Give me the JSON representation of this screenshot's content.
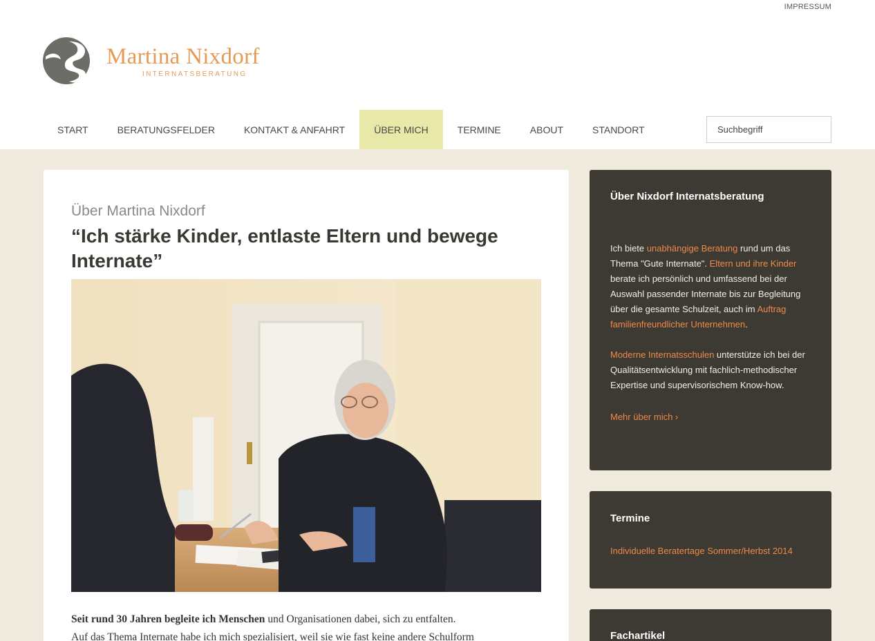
{
  "util_nav": {
    "impressum": "IMPRESSUM"
  },
  "brand": {
    "name": "Martina Nixdorf",
    "tagline": "INTERNATSBERATUNG"
  },
  "nav": {
    "items": [
      "START",
      "BERATUNGSFELDER",
      "KONTAKT & ANFAHRT",
      "ÜBER MICH",
      "TERMINE",
      "ABOUT",
      "STANDORT"
    ],
    "active": "ÜBER MICH"
  },
  "search": {
    "placeholder": "Suchbegriff"
  },
  "article": {
    "kicker": "Über Martina Nixdorf",
    "headline": "“Ich stärke Kinder, entlaste Eltern und bewege Internate”",
    "photo_alt": "Martina Nixdorf im Beratungsgespräch",
    "body_bold": "Seit rund 30 Jahren begleite ich Menschen",
    "body_rest_1": " und Organisationen dabei, sich zu entfalten.",
    "body_line_2": "Auf das Thema Internate habe ich mich spezialisiert, weil sie wie fast keine andere Schulform"
  },
  "sidebar": {
    "about": {
      "title": "Über Nixdorf Internatsberatung",
      "p1_a": "Ich biete ",
      "p1_link1": "unabhängige Beratung",
      "p1_b": " rund um das Thema \"Gute Internate\". ",
      "p1_link2": "Eltern und ihre Kinder",
      "p1_c": " berate ich persönlich und umfassend bei der Auswahl passender Internate bis zur Begleitung über die gesamte Schulzeit, auch im ",
      "p1_link3": "Auftrag familienfreundlicher Unternehmen",
      "p1_d": ".",
      "p2_link": "Moderne Internatsschulen",
      "p2_text": " unterstütze ich bei der Qualitätsentwicklung mit fachlich-methodischer Expertise und supervisorischem Know-how.",
      "more": "Mehr über mich ›"
    },
    "termine": {
      "title": "Termine",
      "link": "Individuelle Beratertage Sommer/Herbst 2014"
    },
    "fachartikel": {
      "title": "Fachartikel"
    }
  },
  "colors": {
    "accent": "#f08a4b",
    "brand": "#e59a55",
    "widget_bg": "#3c3a33",
    "page_bg": "#f1ebdf",
    "nav_active": "#e8e9a8"
  }
}
